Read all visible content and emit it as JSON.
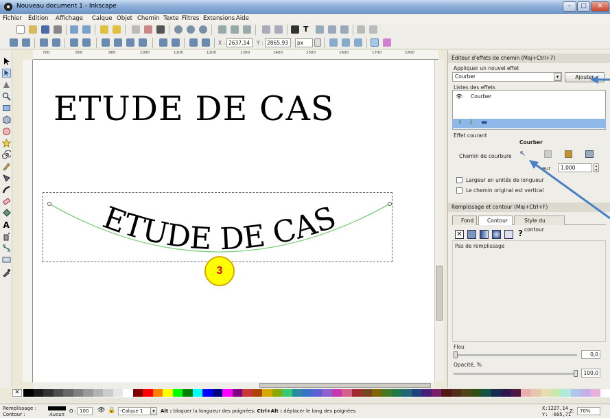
{
  "window": {
    "title": "Nouveau document 1 - Inkscape",
    "min": "–",
    "max": "□",
    "close": "✕"
  },
  "menu": [
    "Fichier",
    "Édition",
    "Affichage",
    "Calque",
    "Objet",
    "Chemin",
    "Texte",
    "Filtres",
    "Extensions",
    "Aide"
  ],
  "toolbar2": {
    "x_label": "X :",
    "x_value": "2637,14",
    "y_label": "Y :",
    "y_value": "2865,93",
    "unit": "px"
  },
  "ruler": {
    "labels": [
      "700",
      "800",
      "900",
      "1000",
      "1100",
      "1200",
      "1300",
      "1400",
      "1500",
      "1600",
      "1700",
      "1800"
    ]
  },
  "canvas": {
    "heading": "ETUDE DE CAS",
    "curved_text": "ETUDE DE CAS",
    "callout_number": "3"
  },
  "lpe_panel": {
    "title": "Éditeur d'effets de chemin (Maj+Ctrl+7)",
    "apply_label": "Appliquer un nouvel effet",
    "effect_select": "Courber",
    "add_button": "Ajouter",
    "list_label": "Listes des effets",
    "effects": [
      "Courber"
    ],
    "current_label": "Effet courant",
    "current_name": "Courber",
    "bend_path_label": "Chemin de courbure",
    "width_label": "eur",
    "width_value": "1,000",
    "opt1": "Largeur en unités de longueur",
    "opt2": "Le chemin original est vertical"
  },
  "fill_panel": {
    "title": "Remplissage et contour (Maj+Ctrl+F)",
    "tabs": [
      "Fond",
      "Contour",
      "Style du contour"
    ],
    "no_fill": "Pas de remplissage",
    "blur_label": "Flou",
    "blur_value": "0,0",
    "opacity_label": "Opacité, %",
    "opacity_value": "100,0"
  },
  "status": {
    "fill_label": "Remplissage :",
    "stroke_label": "Contour :",
    "stroke_value": "Aucun",
    "o_label": "O :",
    "o_value": "100",
    "layer": "-Calque 1",
    "message_bold1": "Alt :",
    "message1": " bloquer la longueur des poignées; ",
    "message_bold2": "Ctrl+Alt :",
    "message2": " déplacer le long des poignées",
    "coord_x": "X:1227,14",
    "coord_y": "Y: -605,71",
    "zoom_label": "Z:",
    "zoom": "70%"
  },
  "colors": {
    "accent_arrow": "#4a7fc1",
    "callout_fill": "#ffff00",
    "callout_text": "#e00000",
    "bend_path": "#7ccd7c"
  }
}
